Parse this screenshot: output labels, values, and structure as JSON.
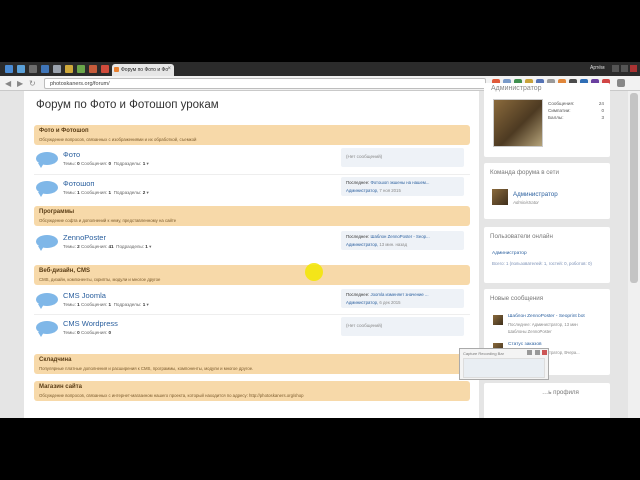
{
  "browser": {
    "tab_title": "Форум по Фото и Фо",
    "tab_close": "×",
    "user_label": "Артём",
    "url": "photoskaners.org/forum/",
    "nav_back": "◀",
    "nav_forward": "▶",
    "nav_reload": "↻"
  },
  "forum": {
    "title": "Форум по Фото и Фотошоп урокам",
    "categories": [
      {
        "title": "Фото и Фотошоп",
        "desc": "Обсуждение вопросов, связанных с изображениями и их обработкой, съемкой"
      },
      {
        "title": "Программы",
        "desc": "Обсуждение софта и дополнений к нему, представленному на сайте"
      },
      {
        "title": "Веб-дизайн, CMS",
        "desc": "CMS, дизайн, компоненты, скрипты, модули и многое другое"
      },
      {
        "title": "Складчина",
        "desc": "Популярные платные дополнения и расширения к CMS, программы, компоненты, модули и многое другое."
      },
      {
        "title": "Магазин сайта",
        "desc": "Обсуждение вопросов, связанных с интернет-магазином нашего проекта, который находится по адресу: http://photoskaners.org/shop"
      }
    ],
    "nodes": [
      {
        "title": "Фото",
        "topics_label": "Темы:",
        "topics": "0",
        "msgs_label": "Сообщения:",
        "msgs": "0",
        "subs_label": "Подразделы:",
        "subs": "1",
        "last": null,
        "empty": "(Нет сообщений)"
      },
      {
        "title": "Фотошоп",
        "topics_label": "Темы:",
        "topics": "1",
        "msgs_label": "Сообщения:",
        "msgs": "1",
        "subs_label": "Подразделы:",
        "subs": "2",
        "last_prefix": "Последнее:",
        "last_title": "Фотошоп экшены на нашем...",
        "last_author": "Администратор,",
        "last_date": "7 ноя 2015"
      },
      {
        "title": "ZennoPoster",
        "topics_label": "Темы:",
        "topics": "2",
        "msgs_label": "Сообщения:",
        "msgs": "41",
        "subs_label": "Подразделы:",
        "subs": "1",
        "last_prefix": "Последнее:",
        "last_title": "Шаблон ZennoPoster - Seop...",
        "last_author": "Администратор,",
        "last_date": "13 мин. назад"
      },
      {
        "title": "CMS Joomla",
        "topics_label": "Темы:",
        "topics": "1",
        "msgs_label": "Сообщения:",
        "msgs": "1",
        "subs_label": "Подразделы:",
        "subs": "1",
        "last_prefix": "Последнее:",
        "last_title": "Joomla изменяет значение ...",
        "last_author": "Администратор,",
        "last_date": "6 дек 2015"
      },
      {
        "title": "CMS Wordpress",
        "topics_label": "Темы:",
        "topics": "0",
        "msgs_label": "Сообщения:",
        "msgs": "0",
        "subs_label": "",
        "subs": "",
        "last": null,
        "empty": "(Нет сообщений)"
      }
    ]
  },
  "sidebar": {
    "profile": {
      "name": "Администратор",
      "stats": [
        {
          "label": "Сообщения:",
          "value": "24"
        },
        {
          "label": "Симпатии:",
          "value": "0"
        },
        {
          "label": "Баллы:",
          "value": "3"
        }
      ]
    },
    "team": {
      "head": "Команда форума в сети",
      "name": "Администратор",
      "role": "Administrator"
    },
    "online": {
      "head": "Пользователи онлайн",
      "name": "Администратор",
      "summary": "Всего: 1 (пользователей: 1, гостей: 0, роботов: 0)"
    },
    "new_msgs": {
      "head": "Новые сообщения",
      "items": [
        {
          "title": "Шаблон ZennoPoster - Seoprint bot",
          "meta": "Последнее: Администратор, 13 мин",
          "forum": "Шаблоны ZennoPoster"
        },
        {
          "title": "Статус заказов",
          "meta": "Последнее: Администратор, Вчера...",
          "forum": "Магазин сайта"
        }
      ]
    },
    "bottom": {
      "head": "…ь профиля"
    }
  },
  "popup": {
    "title": "Capture Recording Bar"
  },
  "colors": {
    "accent": "#2a5f9e",
    "category_bg": "#f7d9a9",
    "bubble": "#7fb7e8"
  }
}
